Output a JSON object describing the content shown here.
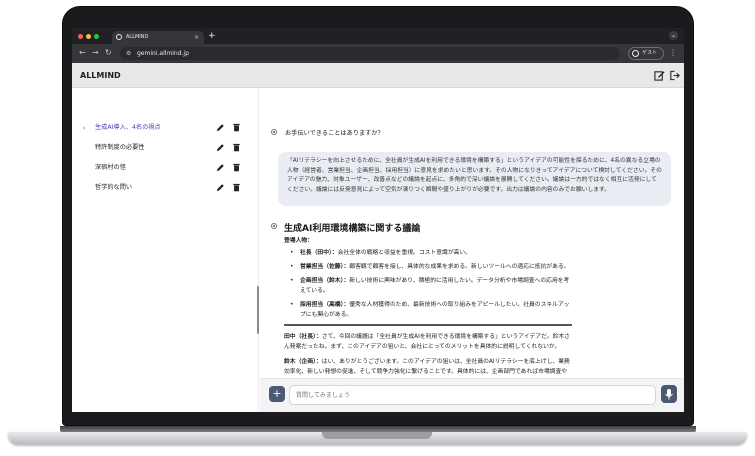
{
  "browser": {
    "tab_title": "ALLMIND",
    "tab_close": "×",
    "new_tab": "+",
    "tab_menu": "⌄",
    "url": "gemini.allmind.jp",
    "guest_label": "ゲスト",
    "back": "←",
    "forward": "→",
    "reload": "↻",
    "more": "⋮"
  },
  "app": {
    "title": "ALLMIND"
  },
  "sidebar": {
    "chevron": "›",
    "items": [
      {
        "label": "生成AI導入、4名の視点",
        "active": true
      },
      {
        "label": "特許制度の必要性",
        "active": false
      },
      {
        "label": "深宿村の怪",
        "active": false
      },
      {
        "label": "哲学的な問い",
        "active": false
      }
    ]
  },
  "chat": {
    "greeting": "お手伝いできることはありますか？",
    "user_message": "「AIリテラシーを向上させるために、全社員が生成AIを利用できる環境を構築する」というアイデアの可能性を探るために、4名の異なる立場の人物（経営者、営業担当、企画担当、採用担当）に意見を求めたいと思います。その人物になりきってアイデアについて検討してください。そのアイデアの魅力、対象ユーザー、改善点などの議論を起点に、多角的で深い議論を展開してください。議論は一方的ではなく相互に活発にしてください。議論には反発意見によって空気が凍りつく瞬間や盛り上がりが必要です。出力は議論の内容のみでお願いします。",
    "answer_title": "生成AI利用環境構築に関する議論",
    "speakers_heading": "登場人物：",
    "speakers": [
      {
        "name": "社長（田中）：",
        "desc": "会社全体の戦略と収益を重視。コスト意識が高い。"
      },
      {
        "name": "営業担当（佐藤）：",
        "desc": "顧客観で顧客を接し、具体的な成果を求める。新しいツールへの適応に抵抗がある。"
      },
      {
        "name": "企画担当（鈴木）：",
        "desc": "新しい技術に興味があり、積極的に活用したい。データ分析や市場調査への応用を考えている。"
      },
      {
        "name": "採用担当（高橋）：",
        "desc": "優秀な人材獲得のため、最新技術への取り組みをアピールしたい。社員のスキルアップにも関心がある。"
      }
    ],
    "dialogue": [
      {
        "speaker": "田中（社長）：",
        "text": "さて、今回の議題は「全社員が生成AIを利用できる環境を構築する」というアイデアだ。鈴木さん発案だったね。まず、このアイデアの狙いと、会社にとってのメリットを具体的に説明してくれないか。"
      },
      {
        "speaker": "鈴木（企画）：",
        "text": "はい、ありがとうございます。このアイデアの狙いは、全社員のAIリテラシーを底上げし、業務効率化、新しい発想の促進、そして競争力強化に繋げることです。具体的には、企画部門であれば市場調査や競合分析のスピードアップ、営業部門であれば顧客への提案"
      }
    ]
  },
  "input": {
    "add": "+",
    "placeholder": "質問してみましょう"
  }
}
